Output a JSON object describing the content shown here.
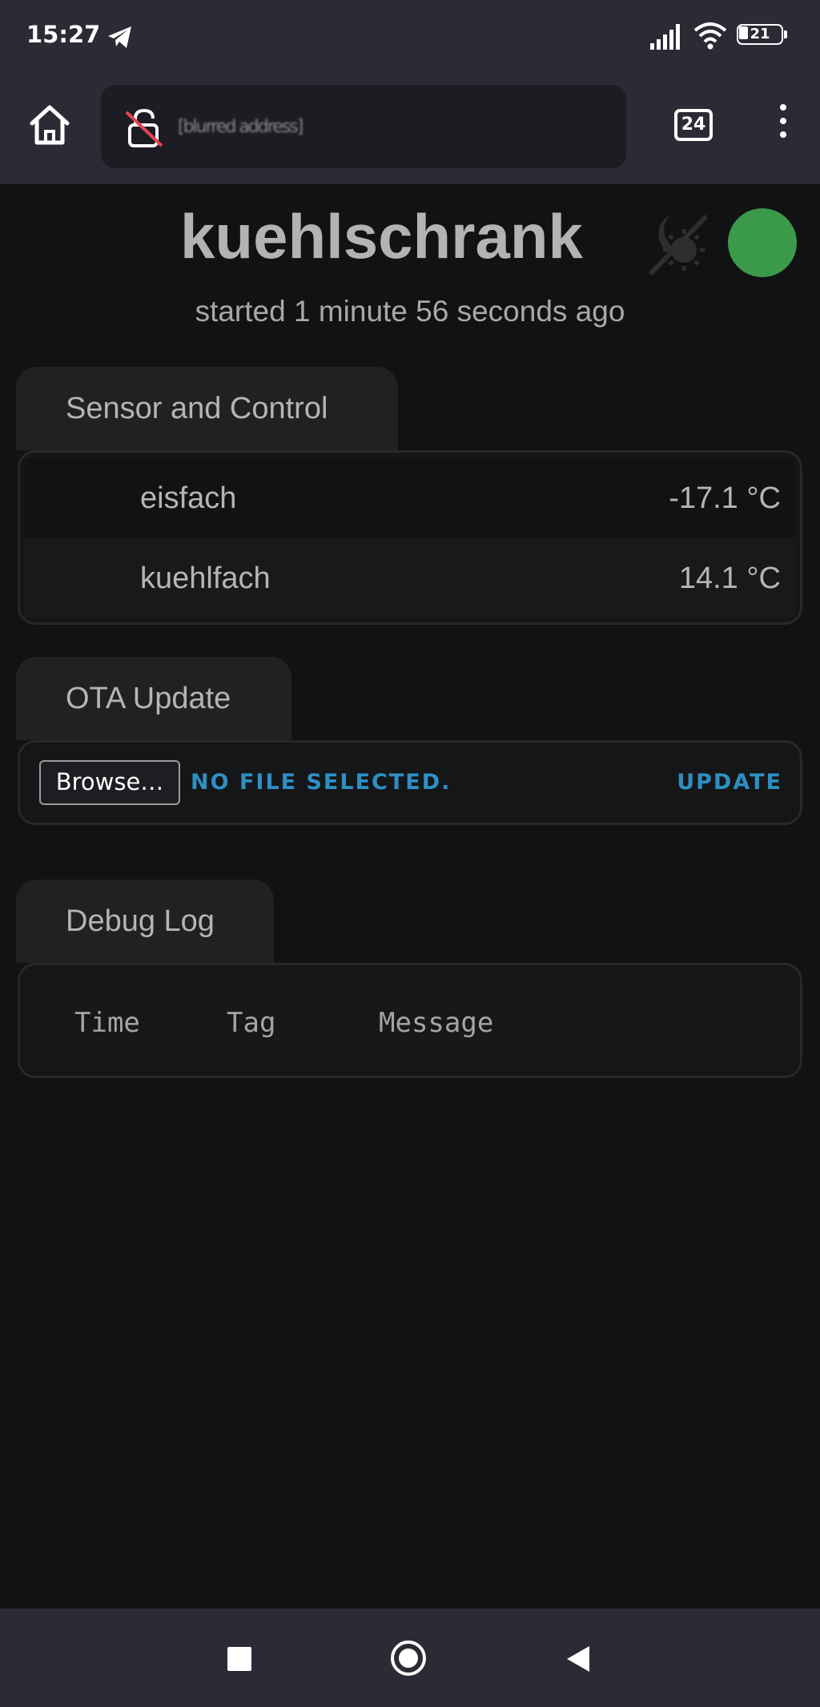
{
  "status_bar": {
    "time": "15:27",
    "telegram_icon": "telegram-icon",
    "signal_icon": "signal-bars-icon",
    "wifi_icon": "wifi-icon",
    "battery_level": "21"
  },
  "browser": {
    "home_icon": "home-icon",
    "lock_icon": "lock-insecure-icon",
    "url_text": "[blurred address]",
    "tab_count": "24",
    "menu_icon": "more-vert-icon"
  },
  "page": {
    "title": "kuehlschrank",
    "subtitle": "started 1 minute 56 seconds ago",
    "theme_icon": "theme-toggle-icon",
    "status_color": "#3a9a4a"
  },
  "sensor_card": {
    "tab_label": "Sensor and Control",
    "rows": [
      {
        "name": "eisfach",
        "value": "-17.1 °C"
      },
      {
        "name": "kuehlfach",
        "value": "14.1 °C"
      }
    ]
  },
  "ota_card": {
    "tab_label": "OTA Update",
    "browse_label": "Browse…",
    "file_status": "NO FILE SELECTED.",
    "update_label": "UPDATE",
    "accent_color": "#2e8fc4"
  },
  "debug_card": {
    "tab_label": "Debug Log",
    "columns": [
      "Time",
      "Tag",
      "Message"
    ]
  },
  "nav_bar": {
    "recents_icon": "recents-square-icon",
    "home_icon": "home-circle-icon",
    "back_icon": "back-triangle-icon"
  }
}
